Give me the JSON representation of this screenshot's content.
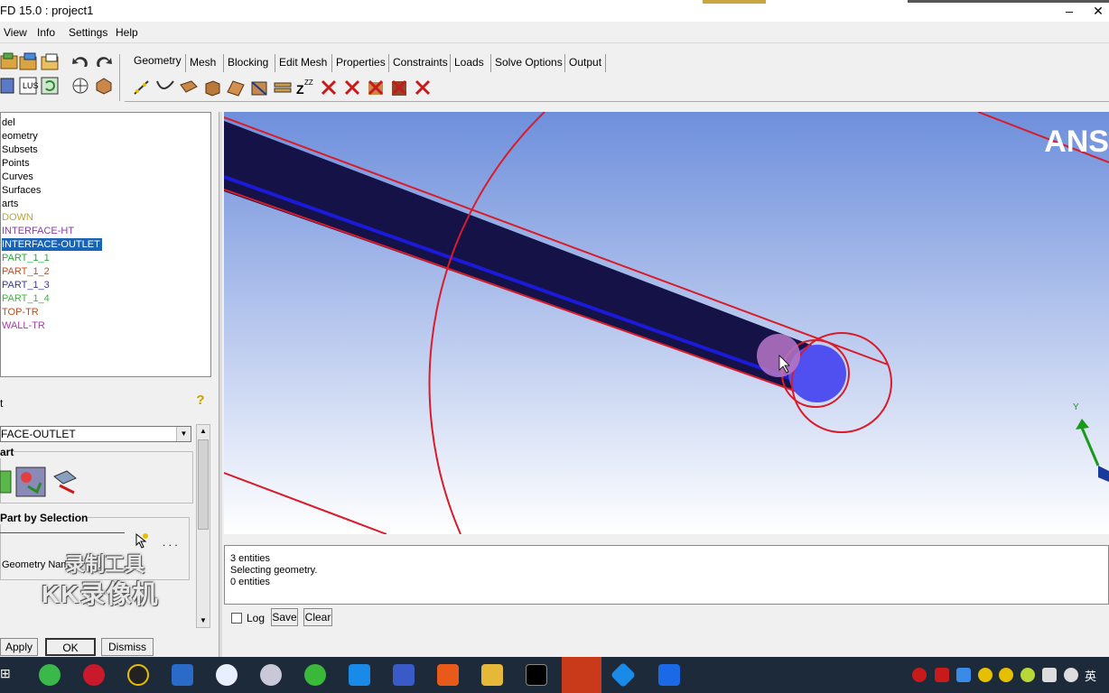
{
  "window": {
    "title": "FD 15.0 : project1",
    "minimize": "–",
    "close": "✕"
  },
  "menu": [
    "View",
    "Info",
    "Settings",
    "Help"
  ],
  "tabs": [
    "Geometry",
    "Mesh",
    "Blocking",
    "Edit Mesh",
    "Properties",
    "Constraints",
    "Loads",
    "Solve Options",
    "Output"
  ],
  "tree": {
    "items": [
      {
        "label": "del",
        "color": "#000000"
      },
      {
        "label": "eometry",
        "color": "#000000"
      },
      {
        "label": "Subsets",
        "color": "#000000"
      },
      {
        "label": "Points",
        "color": "#000000"
      },
      {
        "label": "Curves",
        "color": "#000000"
      },
      {
        "label": "Surfaces",
        "color": "#000000"
      },
      {
        "label": "arts",
        "color": "#000000"
      },
      {
        "label": "DOWN",
        "color": "#b8a838"
      },
      {
        "label": "INTERFACE-HT",
        "color": "#8a3aa8"
      },
      {
        "label": "INTERFACE-OUTLET",
        "color": "#ffffff"
      },
      {
        "label": "PART_1_1",
        "color": "#2aa83a"
      },
      {
        "label": "PART_1_2",
        "color": "#c84a1a"
      },
      {
        "label": "PART_1_3",
        "color": "#3a3a9a"
      },
      {
        "label": "PART_1_4",
        "color": "#3ab83a"
      },
      {
        "label": "TOP-TR",
        "color": "#c84a1a"
      },
      {
        "label": "WALL-TR",
        "color": "#a83aa8"
      }
    ]
  },
  "panel": {
    "header": "t",
    "combo_value": "FACE-OUTLET",
    "group1_label": "art",
    "group2_label": "Part by Selection",
    "geometry_names_label": "Geometry Names",
    "dots": ". . .",
    "apply": "Apply",
    "ok": "OK",
    "dismiss": "Dismiss"
  },
  "watermark": {
    "line1": "录制工具",
    "line2": "KK录像机"
  },
  "viewport": {
    "brand": "ANS",
    "axis_label": "Y"
  },
  "console": {
    "lines": [
      "3 entities",
      "Selecting geometry.",
      "0 entities"
    ]
  },
  "logbar": {
    "log": "Log",
    "save": "Save",
    "clear": "Clear"
  },
  "taskbar": {
    "ime": "英"
  }
}
